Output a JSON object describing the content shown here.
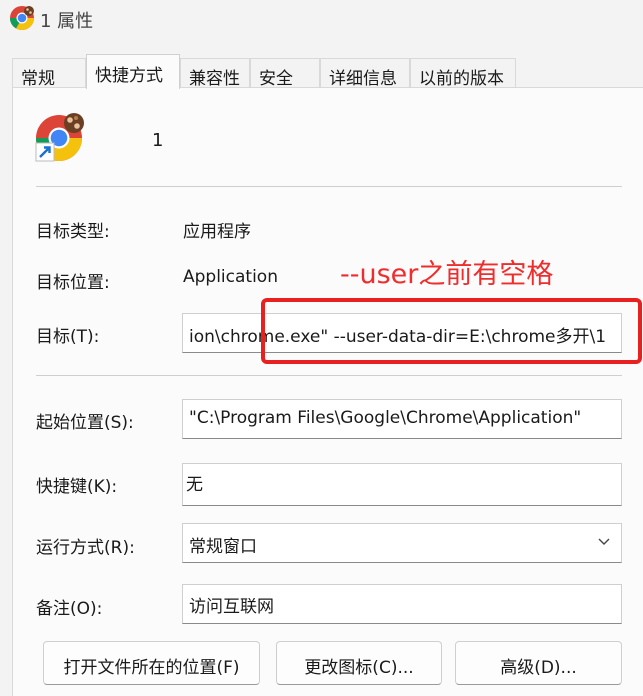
{
  "window": {
    "title": "1 属性"
  },
  "tabs": [
    {
      "label": "常规"
    },
    {
      "label": "快捷方式"
    },
    {
      "label": "兼容性"
    },
    {
      "label": "安全"
    },
    {
      "label": "详细信息"
    },
    {
      "label": "以前的版本"
    }
  ],
  "active_tab": "快捷方式",
  "shortcut": {
    "name": "1"
  },
  "fields": {
    "target_type": {
      "label": "目标类型:",
      "value": "应用程序"
    },
    "target_location": {
      "label": "目标位置:",
      "value": "Application"
    },
    "target": {
      "label": "目标(T):",
      "value": "ion\\chrome.exe\" --user-data-dir=E:\\chrome多开\\1"
    },
    "start_in": {
      "label": "起始位置(S):",
      "value": "\"C:\\Program Files\\Google\\Chrome\\Application\""
    },
    "hotkey": {
      "label": "快捷键(K):",
      "value": "无"
    },
    "run": {
      "label": "运行方式(R):",
      "value": "常规窗口"
    },
    "comment": {
      "label": "备注(O):",
      "value": "访问互联网"
    }
  },
  "annotation": {
    "text": "--user之前有空格",
    "color": "#e82020"
  },
  "buttons": {
    "open_location": "打开文件所在的位置(F)",
    "change_icon": "更改图标(C)...",
    "advanced": "高级(D)..."
  },
  "icons": {
    "app": "chrome-icon",
    "shortcut_arrow": "shortcut-arrow-icon",
    "dropdown": "chevron-down-icon"
  }
}
